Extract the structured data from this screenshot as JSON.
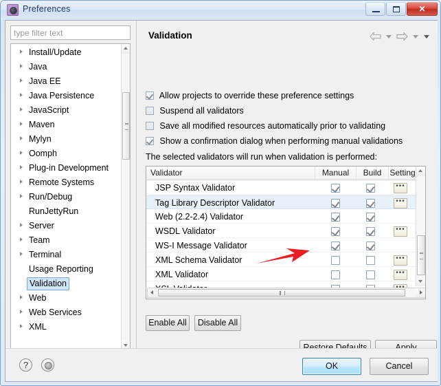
{
  "window": {
    "title": "Preferences",
    "icon": "eclipse-preferences-icon",
    "controls": {
      "minimize": "minimize-button",
      "maximize": "maximize-button",
      "close": "✕"
    }
  },
  "sidebar": {
    "filter": {
      "placeholder": "type filter text",
      "value": ""
    },
    "items": [
      {
        "label": "Install/Update",
        "expandable": true,
        "selected": false
      },
      {
        "label": "Java",
        "expandable": true,
        "selected": false
      },
      {
        "label": "Java EE",
        "expandable": true,
        "selected": false
      },
      {
        "label": "Java Persistence",
        "expandable": true,
        "selected": false
      },
      {
        "label": "JavaScript",
        "expandable": true,
        "selected": false
      },
      {
        "label": "Maven",
        "expandable": true,
        "selected": false
      },
      {
        "label": "Mylyn",
        "expandable": true,
        "selected": false
      },
      {
        "label": "Oomph",
        "expandable": true,
        "selected": false
      },
      {
        "label": "Plug-in Development",
        "expandable": true,
        "selected": false
      },
      {
        "label": "Remote Systems",
        "expandable": true,
        "selected": false
      },
      {
        "label": "Run/Debug",
        "expandable": true,
        "selected": false
      },
      {
        "label": "RunJettyRun",
        "expandable": false,
        "selected": false
      },
      {
        "label": "Server",
        "expandable": true,
        "selected": false
      },
      {
        "label": "Team",
        "expandable": true,
        "selected": false
      },
      {
        "label": "Terminal",
        "expandable": true,
        "selected": false
      },
      {
        "label": "Usage Reporting",
        "expandable": false,
        "selected": false
      },
      {
        "label": "Validation",
        "expandable": false,
        "selected": true
      },
      {
        "label": "Web",
        "expandable": true,
        "selected": false
      },
      {
        "label": "Web Services",
        "expandable": true,
        "selected": false
      },
      {
        "label": "XML",
        "expandable": true,
        "selected": false
      }
    ]
  },
  "page": {
    "title": "Validation",
    "nav": {
      "back": "back-arrow-icon",
      "back_menu": "back-dropdown-icon",
      "forward": "forward-arrow-icon",
      "forward_menu": "forward-dropdown-icon",
      "view_menu": "view-menu-icon"
    },
    "options": [
      {
        "label": "Allow projects to override these preference settings",
        "checked": true
      },
      {
        "label": "Suspend all validators",
        "checked": false
      },
      {
        "label": "Save all modified resources automatically prior to validating",
        "checked": false
      },
      {
        "label": "Show a confirmation dialog when performing manual validations",
        "checked": true
      }
    ],
    "table_caption": "The selected validators will run when validation is performed:",
    "table": {
      "columns": [
        "Validator",
        "Manual",
        "Build",
        "Setting"
      ],
      "rows": [
        {
          "name": "JSP Syntax Validator",
          "manual": true,
          "build": true,
          "setting": true,
          "highlighted": false
        },
        {
          "name": "Tag Library Descriptor Validator",
          "manual": true,
          "build": true,
          "setting": true,
          "highlighted": true
        },
        {
          "name": "Web (2.2-2.4) Validator",
          "manual": true,
          "build": true,
          "setting": false,
          "highlighted": false
        },
        {
          "name": "WSDL Validator",
          "manual": true,
          "build": true,
          "setting": true,
          "highlighted": false
        },
        {
          "name": "WS-I Message Validator",
          "manual": true,
          "build": true,
          "setting": false,
          "highlighted": false
        },
        {
          "name": "XML Schema Validator",
          "manual": false,
          "build": false,
          "setting": true,
          "highlighted": false
        },
        {
          "name": "XML Validator",
          "manual": false,
          "build": false,
          "setting": true,
          "highlighted": false
        },
        {
          "name": "XSL Validator",
          "manual": true,
          "build": true,
          "setting": true,
          "highlighted": false
        }
      ],
      "setting_button_label": "•••"
    },
    "buttons": {
      "enable_all": "Enable All",
      "disable_all": "Disable All",
      "restore_defaults": "Restore Defaults",
      "apply": "Apply"
    }
  },
  "footer": {
    "help": "?",
    "second_icon": "preferences-dot-icon",
    "ok": "OK",
    "cancel": "Cancel"
  },
  "annotation": {
    "type": "red-arrow",
    "color": "#e81e22",
    "points_at": "XML Validator"
  },
  "colors": {
    "title_text": "#1f3864",
    "selection": "#cfe4f7",
    "row_highlight": "#e8f1fa",
    "focus_border": "#3c7fb1",
    "annotation_red": "#e81e22"
  }
}
